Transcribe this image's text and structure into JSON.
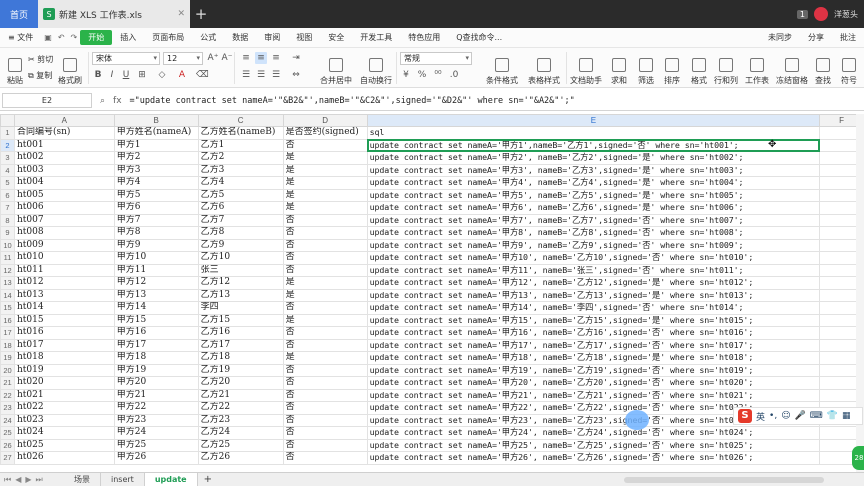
{
  "titlebar": {
    "home_tab": "首页",
    "doc_tab": "新建 XLS 工作表.xls",
    "doc_logo": "S",
    "plus": "+",
    "badge": "1",
    "user": "洋葱头"
  },
  "menubar": {
    "file": "文件",
    "items": [
      "开始",
      "插入",
      "页面布局",
      "公式",
      "数据",
      "审阅",
      "视图",
      "安全",
      "开发工具",
      "特色应用"
    ],
    "search": "Q查找命令...",
    "right": [
      "未同步",
      "分享",
      "批注"
    ]
  },
  "ribbon": {
    "paste": "粘贴",
    "cut": "剪切",
    "copy": "复制",
    "format_painter": "格式刷",
    "font_name": "宋体",
    "font_size": "12",
    "bold": "B",
    "italic": "I",
    "underline": "U",
    "merge": "合并居中",
    "wrap": "自动换行",
    "number_format": "常规",
    "cond_format": "条件格式",
    "table_style": "表格样式",
    "doc_assist": "文档助手",
    "sum": "求和",
    "filter": "筛选",
    "sort": "排序",
    "format": "格式",
    "row_col": "行和列",
    "worksheet": "工作表",
    "freeze": "冻结窗格",
    "find": "查找",
    "symbol": "符号"
  },
  "formula_bar": {
    "cell_ref": "E2",
    "fx": "fx",
    "content": "=\"update contract set nameA='\"&B2&\"',nameB='\"&C2&\"',signed='\"&D2&\"' where sn='\"&A2&\"';\""
  },
  "grid": {
    "columns": [
      "A",
      "B",
      "C",
      "D",
      "E",
      "F"
    ],
    "headers": [
      "合同编号(sn)",
      "甲方姓名(nameA)",
      "乙方姓名(nameB)",
      "是否签约(signed)",
      "sql"
    ],
    "rows": [
      [
        "ht001",
        "甲方1",
        "乙方1",
        "否",
        "update contract set nameA='甲方1',nameB='乙方1',signed='否' where sn='ht001';"
      ],
      [
        "ht002",
        "甲方2",
        "乙方2",
        "是",
        "update contract set nameA='甲方2', nameB='乙方2',signed='是' where sn='ht002';"
      ],
      [
        "ht003",
        "甲方3",
        "乙方3",
        "是",
        "update contract set nameA='甲方3', nameB='乙方3',signed='是' where sn='ht003';"
      ],
      [
        "ht004",
        "甲方4",
        "乙方4",
        "是",
        "update contract set nameA='甲方4', nameB='乙方4',signed='是' where sn='ht004';"
      ],
      [
        "ht005",
        "甲方5",
        "乙方5",
        "是",
        "update contract set nameA='甲方5', nameB='乙方5',signed='是' where sn='ht005';"
      ],
      [
        "ht006",
        "甲方6",
        "乙方6",
        "是",
        "update contract set nameA='甲方6', nameB='乙方6',signed='是' where sn='ht006';"
      ],
      [
        "ht007",
        "甲方7",
        "乙方7",
        "否",
        "update contract set nameA='甲方7', nameB='乙方7',signed='否' where sn='ht007';"
      ],
      [
        "ht008",
        "甲方8",
        "乙方8",
        "否",
        "update contract set nameA='甲方8', nameB='乙方8',signed='否' where sn='ht008';"
      ],
      [
        "ht009",
        "甲方9",
        "乙方9",
        "否",
        "update contract set nameA='甲方9', nameB='乙方9',signed='否' where sn='ht009';"
      ],
      [
        "ht010",
        "甲方10",
        "乙方10",
        "否",
        "update contract set nameA='甲方10', nameB='乙方10',signed='否' where sn='ht010';"
      ],
      [
        "ht011",
        "甲方11",
        "张三",
        "否",
        "update contract set nameA='甲方11', nameB='张三',signed='否' where sn='ht011';"
      ],
      [
        "ht012",
        "甲方12",
        "乙方12",
        "是",
        "update contract set nameA='甲方12', nameB='乙方12',signed='是' where sn='ht012';"
      ],
      [
        "ht013",
        "甲方13",
        "乙方13",
        "是",
        "update contract set nameA='甲方13', nameB='乙方13',signed='是' where sn='ht013';"
      ],
      [
        "ht014",
        "甲方14",
        "李四",
        "否",
        "update contract set nameA='甲方14', nameB='李四',signed='否' where sn='ht014';"
      ],
      [
        "ht015",
        "甲方15",
        "乙方15",
        "是",
        "update contract set nameA='甲方15', nameB='乙方15',signed='是' where sn='ht015';"
      ],
      [
        "ht016",
        "甲方16",
        "乙方16",
        "否",
        "update contract set nameA='甲方16', nameB='乙方16',signed='否' where sn='ht016';"
      ],
      [
        "ht017",
        "甲方17",
        "乙方17",
        "否",
        "update contract set nameA='甲方17', nameB='乙方17',signed='否' where sn='ht017';"
      ],
      [
        "ht018",
        "甲方18",
        "乙方18",
        "是",
        "update contract set nameA='甲方18', nameB='乙方18',signed='是' where sn='ht018';"
      ],
      [
        "ht019",
        "甲方19",
        "乙方19",
        "否",
        "update contract set nameA='甲方19', nameB='乙方19',signed='否' where sn='ht019';"
      ],
      [
        "ht020",
        "甲方20",
        "乙方20",
        "否",
        "update contract set nameA='甲方20', nameB='乙方20',signed='否' where sn='ht020';"
      ],
      [
        "ht021",
        "甲方21",
        "乙方21",
        "否",
        "update contract set nameA='甲方21', nameB='乙方21',signed='否' where sn='ht021';"
      ],
      [
        "ht022",
        "甲方22",
        "乙方22",
        "否",
        "update contract set nameA='甲方22', nameB='乙方22',signed='否' where sn='ht022';"
      ],
      [
        "ht023",
        "甲方23",
        "乙方23",
        "否",
        "update contract set nameA='甲方23', nameB='乙方23',signed='否' where sn='ht023';"
      ],
      [
        "ht024",
        "甲方24",
        "乙方24",
        "否",
        "update contract set nameA='甲方24', nameB='乙方24',signed='否' where sn='ht024';"
      ],
      [
        "ht025",
        "甲方25",
        "乙方25",
        "否",
        "update contract set nameA='甲方25', nameB='乙方25',signed='否' where sn='ht025';"
      ],
      [
        "ht026",
        "甲方26",
        "乙方26",
        "否",
        "update contract set nameA='甲方26', nameB='乙方26',signed='否' where sn='ht026';"
      ]
    ]
  },
  "sheets": {
    "tabs": [
      "场景",
      "insert",
      "update"
    ],
    "active": "update",
    "add": "+"
  },
  "ime": {
    "logo": "S",
    "lang": "英",
    "badge": "28"
  },
  "colors": {
    "accent": "#2bb34a",
    "selection": "#1f9d55",
    "home_tab": "#3f77d8"
  }
}
